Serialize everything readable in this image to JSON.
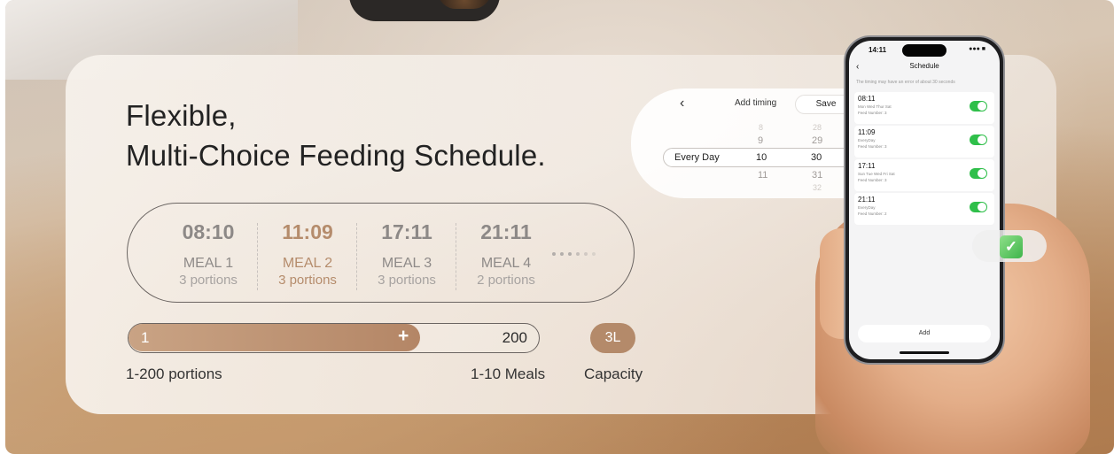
{
  "headline": {
    "line1": "Flexible,",
    "line2": "Multi-Choice Feeding Schedule."
  },
  "meals": [
    {
      "time": "08:10",
      "name": "MEAL 1",
      "portions": "3 portions",
      "active": false
    },
    {
      "time": "11:09",
      "name": "MEAL 2",
      "portions": "3 portions",
      "active": true
    },
    {
      "time": "17:11",
      "name": "MEAL 3",
      "portions": "3 portions",
      "active": false
    },
    {
      "time": "21:11",
      "name": "MEAL 4",
      "portions": "2 portions",
      "active": false
    }
  ],
  "slider": {
    "min_label": "1",
    "plus_icon": "plus-icon",
    "max_label": "200",
    "fill_fraction": 0.71
  },
  "capacity_badge": "3L",
  "captions": {
    "portions": "1-200 portions",
    "meals": "1-10 Meals",
    "capacity": "Capacity"
  },
  "add_timing": {
    "title": "Add timing",
    "save_label": "Save",
    "repeat_label": "Every Day",
    "hours": [
      "8",
      "9",
      "10",
      "11"
    ],
    "minutes": [
      "28",
      "29",
      "30",
      "31",
      "32"
    ],
    "selected_hour": "10",
    "selected_minute": "30"
  },
  "phone": {
    "status_time": "14:11",
    "title": "Schedule",
    "note": "The timing may have an error of about 30 seconds",
    "items": [
      {
        "time": "08:11",
        "days": "Mon Wed Thur Sat",
        "feed": "Feed Number: 3",
        "enabled": true
      },
      {
        "time": "11:09",
        "days": "EveryDay",
        "feed": "Feed Number: 3",
        "enabled": true
      },
      {
        "time": "17:11",
        "days": "Sun Tue Wed Fri Sat",
        "feed": "Feed Number: 3",
        "enabled": true
      },
      {
        "time": "21:11",
        "days": "EveryDay",
        "feed": "Feed Number: 2",
        "enabled": true
      }
    ],
    "add_label": "Add"
  },
  "colors": {
    "accent": "#b48a6a",
    "toggle_on": "#2fbf4a",
    "check": "#3fb44a"
  }
}
